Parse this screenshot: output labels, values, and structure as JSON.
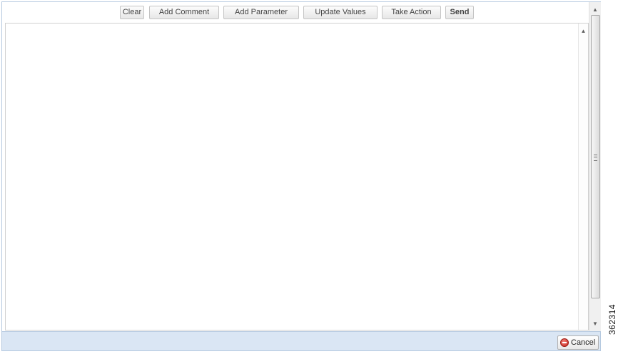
{
  "toolbar": {
    "buttons": [
      {
        "label": "Clear"
      },
      {
        "label": "Add Comment"
      },
      {
        "label": "Add Parameter"
      },
      {
        "label": "Update Values"
      },
      {
        "label": "Take Action"
      },
      {
        "label": "Send"
      }
    ]
  },
  "editor": {
    "content": ""
  },
  "footer": {
    "cancel_label": "Cancel"
  },
  "figure_id": "362314",
  "icons": {
    "cancel": "cancel-circle-icon",
    "scroll_up": "arrow-up-icon",
    "scroll_down": "arrow-down-icon"
  }
}
